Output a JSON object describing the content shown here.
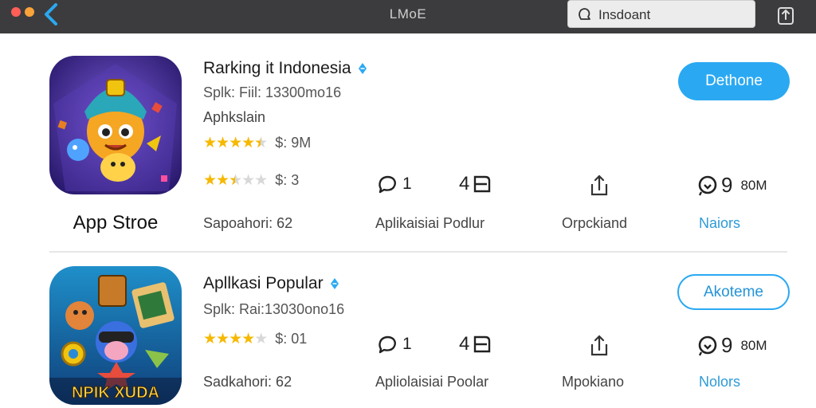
{
  "window": {
    "title": "LMoE",
    "search_text": "Insdoant"
  },
  "apps": [
    {
      "title": "Rarking it Indonesia",
      "size_line": "Splk: Fiil: 13300mo16",
      "category": "Aphkslain",
      "rating_primary": {
        "stars": 4.5,
        "label": "$: 9M"
      },
      "rating_secondary": {
        "stars": 2.5,
        "label": "$: 3"
      },
      "comments": "1",
      "count": "4",
      "downloads_big": "9",
      "downloads_small": "80M",
      "labels": [
        "Sapoahori: 62",
        "Aplikaisiai Podlur",
        "Orpckiand",
        "Naiors"
      ],
      "button": "Dethone",
      "store_caption": "App Stroe"
    },
    {
      "title": "Apllkasi Popular",
      "size_line": "Splk: Rai:13030ono16",
      "rating_primary": {
        "stars": 4,
        "label": "$: 01"
      },
      "comments": "1",
      "count": "4",
      "downloads_big": "9",
      "downloads_small": "80M",
      "labels": [
        "Sadkahori: 62",
        "Apliolaisiai Poolar",
        "Mpokiano",
        "Nolors"
      ],
      "button": "Akoteme",
      "icon_banner": "NPIK XUDA"
    }
  ],
  "colors": {
    "accent": "#2aa9f2",
    "titlebar": "#3c3c3e",
    "star": "#f6b800"
  }
}
